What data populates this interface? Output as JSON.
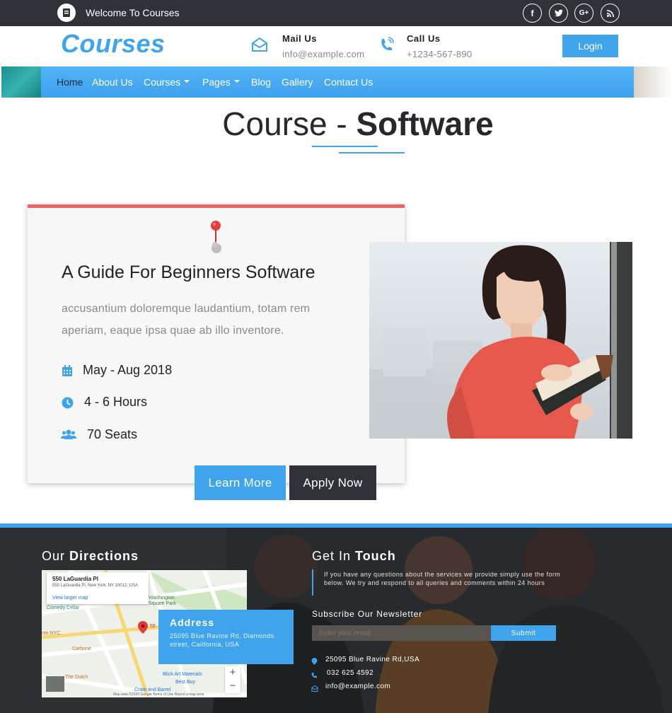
{
  "topbar": {
    "welcome": "Welcome To Courses",
    "social": [
      {
        "icon": "facebook-icon",
        "glyph": "f"
      },
      {
        "icon": "twitter-icon",
        "glyph": "t"
      },
      {
        "icon": "google-plus-icon",
        "glyph": "G+"
      },
      {
        "icon": "rss-icon",
        "glyph": "rss"
      }
    ]
  },
  "header": {
    "brand": "Courses",
    "mail_title": "Mail Us",
    "mail_value": "info@example.com",
    "call_title": "Call Us",
    "call_value": "+1234-567-890",
    "login": "Login"
  },
  "nav": {
    "items": [
      {
        "label": "Home",
        "active": true
      },
      {
        "label": "About Us"
      },
      {
        "label": "Courses",
        "dropdown": true
      },
      {
        "label": "Pages",
        "dropdown": true
      },
      {
        "label": "Blog"
      },
      {
        "label": "Gallery"
      },
      {
        "label": "Contact Us"
      }
    ]
  },
  "page": {
    "title_light": "Course - ",
    "title_bold": "Software"
  },
  "course": {
    "title": "A Guide For Beginners Software",
    "description": "accusantium doloremque laudantium, totam rem aperiam, eaque ipsa quae ab illo inventore.",
    "dates": "May - Aug 2018",
    "hours": "4 - 6 Hours",
    "seats": "70 Seats",
    "learn_more": "Learn More",
    "apply_now": "Apply Now"
  },
  "footer": {
    "directions_light": "Our ",
    "directions_bold": "Directions",
    "map": {
      "place_name": "550 LaGuardia Pl",
      "place_address": "550 LaGuardia Pl, New York, NY 10012, USA",
      "view_larger": "View larger map",
      "labels": [
        "Comedy Cellar",
        "Washington Square Park",
        "nte NYC",
        "Carbone",
        "The Dutch",
        "Blick Art Materials",
        "Best Buy",
        "Crate and Barrel",
        "55"
      ],
      "attribution": "Map data ©2020 Google  Terms of Use  Report a map error",
      "zoom_in": "+",
      "zoom_out": "−"
    },
    "address_title": "Address",
    "address_text": "25095 Blue Ravine Rd, Diamonds street, California, USA",
    "touch_light": "Get In ",
    "touch_bold": "Touch",
    "touch_text": "If you have any questions about the services we provide simply use the form below. We try and respond to all queries and comments within 24 hours",
    "newsletter_title": "Subscribe Our Newsletter",
    "email_placeholder": "Enter your email",
    "submit": "Submit",
    "contact_address": "25095 Blue Ravine Rd,USA",
    "contact_phone": "032 625 4592",
    "contact_email": "info@example.com"
  },
  "colors": {
    "accent": "#3fa4ec",
    "dark": "#2f3238",
    "card_top": "#e96566"
  }
}
